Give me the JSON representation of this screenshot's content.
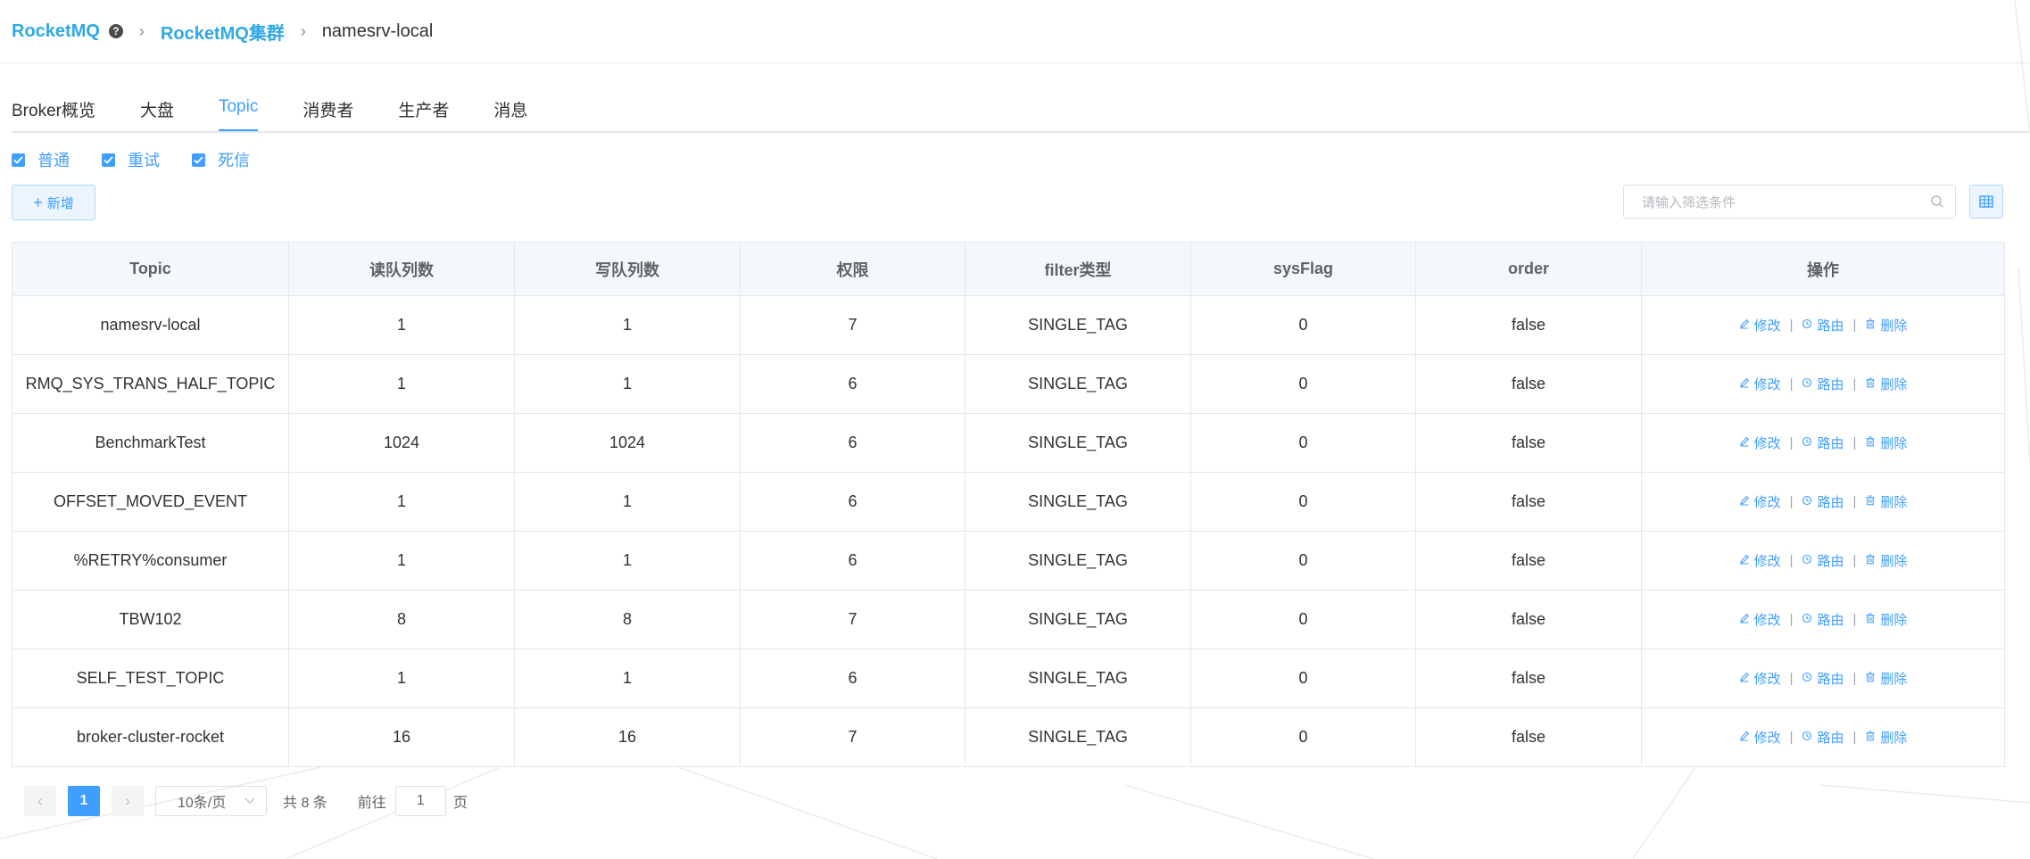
{
  "breadcrumb": {
    "root": "RocketMQ",
    "cluster": "RocketMQ集群",
    "current": "namesrv-local"
  },
  "tabs": [
    {
      "label": "Broker概览",
      "active": false
    },
    {
      "label": "大盘",
      "active": false
    },
    {
      "label": "Topic",
      "active": true
    },
    {
      "label": "消费者",
      "active": false
    },
    {
      "label": "生产者",
      "active": false
    },
    {
      "label": "消息",
      "active": false
    }
  ],
  "filters": [
    {
      "label": "普通",
      "checked": true
    },
    {
      "label": "重试",
      "checked": true
    },
    {
      "label": "死信",
      "checked": true
    }
  ],
  "toolbar": {
    "add_label": "新增",
    "search_placeholder": "请输入筛选条件"
  },
  "table": {
    "headers": [
      "Topic",
      "读队列数",
      "写队列数",
      "权限",
      "filter类型",
      "sysFlag",
      "order",
      "操作"
    ],
    "actions": {
      "edit": "修改",
      "route": "路由",
      "delete": "删除"
    },
    "rows": [
      [
        "namesrv-local",
        "1",
        "1",
        "7",
        "SINGLE_TAG",
        "0",
        "false"
      ],
      [
        "RMQ_SYS_TRANS_HALF_TOPIC",
        "1",
        "1",
        "6",
        "SINGLE_TAG",
        "0",
        "false"
      ],
      [
        "BenchmarkTest",
        "1024",
        "1024",
        "6",
        "SINGLE_TAG",
        "0",
        "false"
      ],
      [
        "OFFSET_MOVED_EVENT",
        "1",
        "1",
        "6",
        "SINGLE_TAG",
        "0",
        "false"
      ],
      [
        "%RETRY%consumer",
        "1",
        "1",
        "6",
        "SINGLE_TAG",
        "0",
        "false"
      ],
      [
        "TBW102",
        "8",
        "8",
        "7",
        "SINGLE_TAG",
        "0",
        "false"
      ],
      [
        "SELF_TEST_TOPIC",
        "1",
        "1",
        "6",
        "SINGLE_TAG",
        "0",
        "false"
      ],
      [
        "broker-cluster-rocket",
        "16",
        "16",
        "7",
        "SINGLE_TAG",
        "0",
        "false"
      ]
    ]
  },
  "pagination": {
    "current_page": "1",
    "page_size": "10条/页",
    "total": "共 8 条",
    "goto_prefix": "前往",
    "goto_value": "1",
    "goto_suffix": "页"
  },
  "colors": {
    "brand": "#2ea8e6",
    "accent": "#409eff",
    "header_bg": "#f4f7fb"
  }
}
